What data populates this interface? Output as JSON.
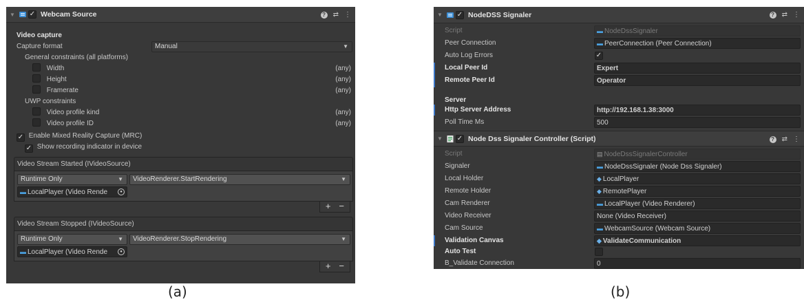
{
  "panel_a": {
    "component_title": "Webcam Source",
    "section_video_capture": "Video capture",
    "capture_format_label": "Capture format",
    "capture_format_value": "Manual",
    "general_constraints": "General constraints (all platforms)",
    "width_label": "Width",
    "height_label": "Height",
    "framerate_label": "Framerate",
    "any": "(any)",
    "uwp_constraints": "UWP constraints",
    "video_profile_kind": "Video profile kind",
    "video_profile_id": "Video profile ID",
    "enable_mrc": "Enable Mixed Reality Capture (MRC)",
    "show_recording": "Show recording indicator in device",
    "event_started": {
      "title": "Video Stream Started (IVideoSource)",
      "runtime": "Runtime Only",
      "function": "VideoRenderer.StartRendering",
      "object": "LocalPlayer (Video Rende"
    },
    "event_stopped": {
      "title": "Video Stream Stopped (IVideoSource)",
      "runtime": "Runtime Only",
      "function": "VideoRenderer.StopRendering",
      "object": "LocalPlayer (Video Rende"
    },
    "plus": "+",
    "minus": "−"
  },
  "panel_b": {
    "signaler_title": "NodeDSS Signaler",
    "script_label": "Script",
    "script_value": "NodeDssSignaler",
    "peer_connection_label": "Peer Connection",
    "peer_connection_value": "PeerConnection (Peer Connection)",
    "auto_log_errors_label": "Auto Log Errors",
    "local_peer_id_label": "Local Peer Id",
    "local_peer_id_value": "Expert",
    "remote_peer_id_label": "Remote Peer Id",
    "remote_peer_id_value": "Operator",
    "server_label": "Server",
    "http_server_label": "Http Server Address",
    "http_server_value": "http://192.168.1.38:3000",
    "poll_time_label": "Poll Time Ms",
    "poll_time_value": "500",
    "controller_title": "Node Dss Signaler Controller (Script)",
    "controller_script_value": "NodeDssSignalerController",
    "signaler_label": "Signaler",
    "signaler_value": "NodeDssSignaler (Node Dss Signaler)",
    "local_holder_label": "Local Holder",
    "local_holder_value": "LocalPlayer",
    "remote_holder_label": "Remote Holder",
    "remote_holder_value": "RemotePlayer",
    "cam_renderer_label": "Cam Renderer",
    "cam_renderer_value": "LocalPlayer (Video Renderer)",
    "video_receiver_label": "Video Receiver",
    "video_receiver_value": "None (Video Receiver)",
    "cam_source_label": "Cam Source",
    "cam_source_value": "WebcamSource (Webcam Source)",
    "validation_canvas_label": "Validation Canvas",
    "validation_canvas_value": "ValidateCommunication",
    "auto_test_label": "Auto Test",
    "b_validate_label": "B_Validate Connection",
    "b_validate_value": "0"
  },
  "captions": {
    "a": "(a)",
    "b": "(b)"
  },
  "colors": {
    "panel_bg": "#383838",
    "accent_blue": "#3c78c8",
    "field_bg": "#2a2a2a"
  }
}
